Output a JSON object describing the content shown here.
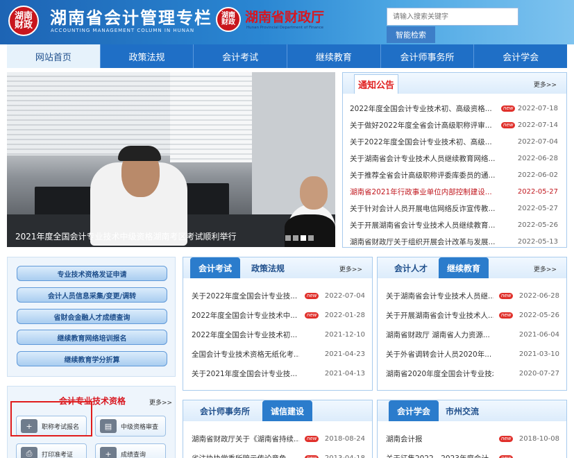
{
  "header": {
    "seal_text": "湖南财政",
    "site_title": "湖南省会计管理专栏",
    "site_subtitle": "ACCOUNTING MANAGEMENT COLUMN IN HUNAN",
    "dept_name": "湖南省财政厅",
    "dept_subtitle": "Hunan Provincial Department of Finance",
    "search_placeholder": "请输入搜索关键字",
    "search_button": "智能检索"
  },
  "nav": [
    "网站首页",
    "政策法规",
    "会计考试",
    "继续教育",
    "会计师事务所",
    "会计学会"
  ],
  "slider": {
    "caption": "2021年度全国会计专业技术中级资格湖南考区考试顺利举行",
    "dot_count": 4,
    "active_dot": 2
  },
  "notice": {
    "title": "通知公告",
    "more": "更多>>",
    "items": [
      {
        "title": "2022年度全国会计专业技术初、高级资格...",
        "date": "2022-07-18",
        "new": "new",
        "red": false
      },
      {
        "title": "关于做好2022年度全省会计高级职称评审...",
        "date": "2022-07-14",
        "new": "new",
        "red": false
      },
      {
        "title": "关于2022年度全国会计专业技术初、高级...",
        "date": "2022-07-04",
        "new": "",
        "red": false
      },
      {
        "title": "关于湖南省会计专业技术人员继续教育网络...",
        "date": "2022-06-28",
        "new": "",
        "red": false
      },
      {
        "title": "关于推荐全省会计高级职称评委库委员的通...",
        "date": "2022-06-02",
        "new": "",
        "red": false
      },
      {
        "title": "湖南省2021年行政事业单位内部控制建设...",
        "date": "2022-05-27",
        "new": "",
        "red": true
      },
      {
        "title": "关于针对会计人员开展电信网络反诈宣传教...",
        "date": "2022-05-27",
        "new": "",
        "red": false
      },
      {
        "title": "关于开展湖南省会计专业技术人员继续教育...",
        "date": "2022-05-26",
        "new": "",
        "red": false
      },
      {
        "title": "湖南省财政厅关于组织开展会计改革与发展...",
        "date": "2022-05-13",
        "new": "",
        "red": false
      }
    ]
  },
  "quick_links": [
    "专业技术资格发证申请",
    "会计人员信息采集/变更/调转",
    "省财会金融人才成绩查询",
    "继续教育网络培训报名",
    "继续教育学分折算"
  ],
  "qualification": {
    "title": "会计专业技术资格",
    "more": "更多>>",
    "buttons": [
      {
        "icon": "register-icon",
        "glyph": "+",
        "label": "职称考试报名"
      },
      {
        "icon": "document-icon",
        "glyph": "▤",
        "label": "中级资格审查"
      },
      {
        "icon": "print-icon",
        "glyph": "⎙",
        "label": "打印准考证"
      },
      {
        "icon": "score-icon",
        "glyph": "+",
        "label": "成绩查询"
      }
    ]
  },
  "panel_exam": {
    "tab_active": "会计考试",
    "tab_other": "政策法规",
    "more": "更多>>",
    "items": [
      {
        "title": "关于2022年度全国会计专业技...",
        "date": "2022-07-04",
        "new": "new"
      },
      {
        "title": "2022年度全国会计专业技术中...",
        "date": "2022-01-28",
        "new": "new"
      },
      {
        "title": "2022年度全国会计专业技术初...",
        "date": "2021-12-10",
        "new": ""
      },
      {
        "title": "全国会计专业技术资格无纸化考...",
        "date": "2021-04-23",
        "new": ""
      },
      {
        "title": "关于2021年度全国会计专业技...",
        "date": "2021-04-13",
        "new": ""
      }
    ]
  },
  "panel_talent": {
    "tab_other": "会计人才",
    "tab_active": "继续教育",
    "more": "更多>>",
    "items": [
      {
        "title": "关于湖南省会计专业技术人员继...",
        "date": "2022-06-28",
        "new": "new"
      },
      {
        "title": "关于开展湖南省会计专业技术人...",
        "date": "2022-05-26",
        "new": "new"
      },
      {
        "title": "湖南省财政厅 湖南省人力资源...",
        "date": "2021-06-04",
        "new": ""
      },
      {
        "title": "关于外省调转会计人员2020年...",
        "date": "2021-03-10",
        "new": ""
      },
      {
        "title": "湖南省2020年度全国会计专业技术...",
        "date": "2020-07-27",
        "new": ""
      }
    ]
  },
  "panel_cpa": {
    "tab_other": "会计师事务所",
    "tab_active": "诚信建设",
    "items": [
      {
        "title": "湖南省财政厅关于《湖南省持续...",
        "date": "2018-08-24",
        "new": "new"
      },
      {
        "title": "省注协协党委所赔示传论意角...",
        "date": "2013-04-18",
        "new": "new"
      }
    ]
  },
  "panel_assoc": {
    "tab_active": "会计学会",
    "tab_other": "市州交流",
    "items": [
      {
        "title": "湖南会计报",
        "date": "2018-10-08",
        "new": "new"
      },
      {
        "title": "关于征集2022—2023年度会计...",
        "date": "",
        "new": "new"
      }
    ]
  },
  "colors": {
    "header_blue": "#1d64b4",
    "nav_blue": "#1f6fc6",
    "alert_red": "#c0161d"
  }
}
